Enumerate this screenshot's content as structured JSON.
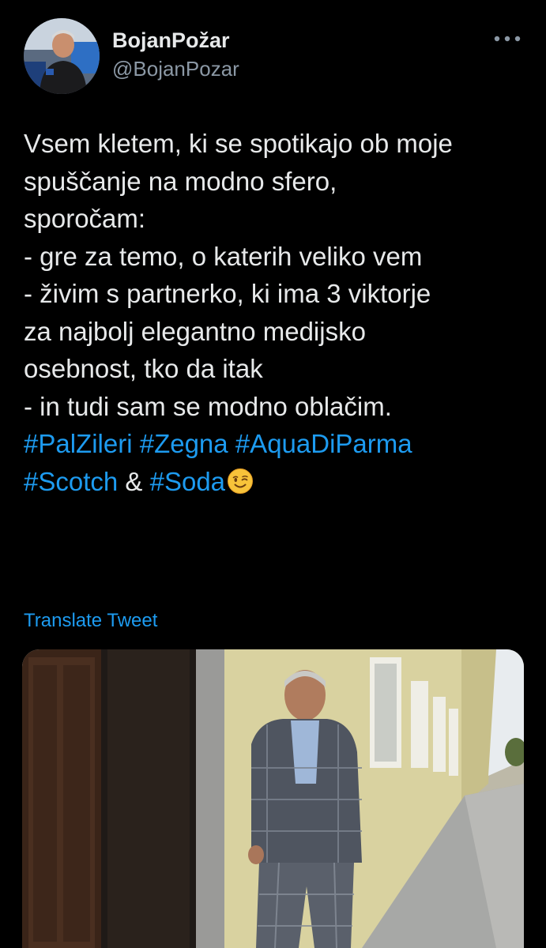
{
  "author": {
    "display_name": "BojanPožar",
    "handle": "@BojanPozar",
    "avatar_icon": "profile-photo"
  },
  "more_icon": "more-horizontal-icon",
  "tweet": {
    "lines": [
      "Vsem kletem, ki se spotikajo ob moje",
      "spuščanje na modno sfero,",
      "sporočam:",
      "- gre za temo, o katerih veliko vem",
      "- živim s partnerko, ki ima 3 viktorje",
      "za najbolj elegantno medijsko",
      "osebnost, tko da itak",
      "- in tudi sam se modno oblačim."
    ],
    "hashtags": {
      "palzileri": "#PalZileri",
      "zegna": "#Zegna",
      "aquadiparma": "#AquaDiParma",
      "scotch": "#Scotch",
      "ampersand": " & ",
      "soda": "#Soda"
    },
    "emoji": "winking-face"
  },
  "translate_label": "Translate Tweet",
  "colors": {
    "background": "#000000",
    "text": "#e7e9ea",
    "secondary": "#8b98a5",
    "link": "#1d9bf0"
  }
}
